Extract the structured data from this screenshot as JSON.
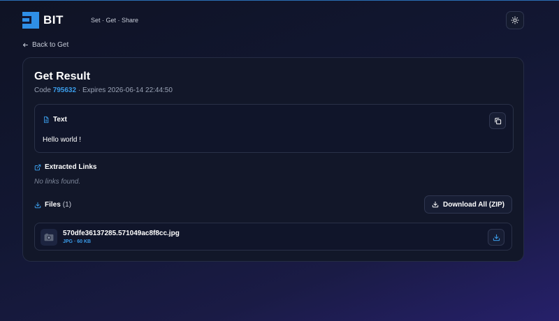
{
  "brand": {
    "name": "BIT",
    "tagline": "Set · Get · Share",
    "accent": "#2f8fe6"
  },
  "header": {
    "theme_toggle_icon": "sun-icon"
  },
  "nav": {
    "back_label": "Back to Get"
  },
  "result": {
    "title": "Get Result",
    "code_label": "Code",
    "code": "795632",
    "expires_label": "· Expires",
    "expires": "2026-06-14 22:44:50"
  },
  "text_section": {
    "heading": "Text",
    "content": "Hello world !",
    "copy_icon": "copy-icon"
  },
  "links_section": {
    "heading": "Extracted Links",
    "empty_message": "No links found."
  },
  "files_section": {
    "heading": "Files",
    "count": "(1)",
    "download_all_label": "Download All (ZIP)",
    "files": [
      {
        "name": "570dfe36137285.571049ac8f8cc.jpg",
        "meta": "JPG · 60 KB",
        "thumb_icon": "image-thumbnail-icon"
      }
    ]
  }
}
